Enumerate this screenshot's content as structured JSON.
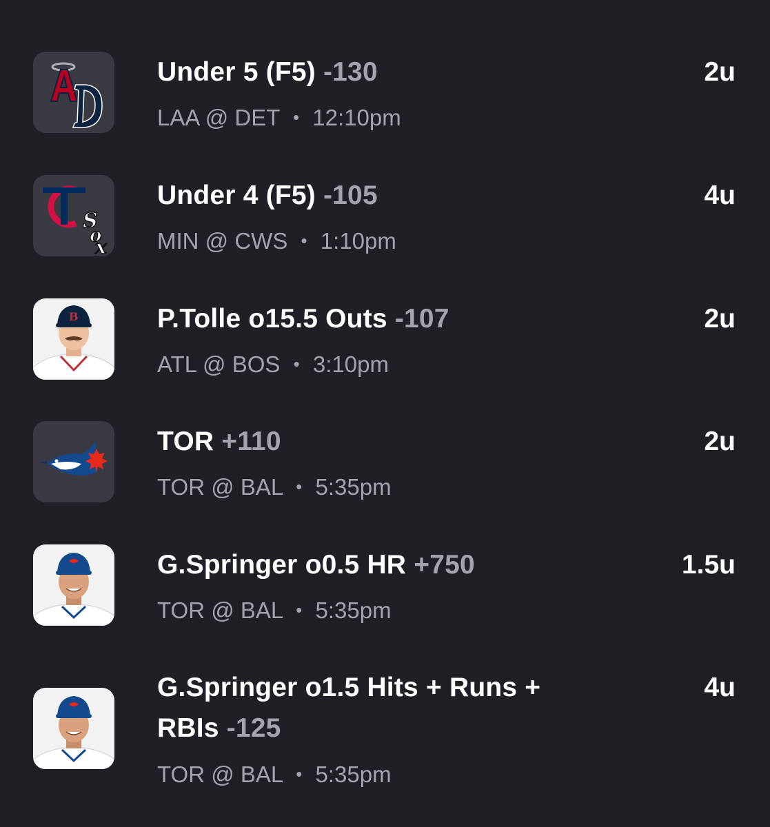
{
  "bets": [
    {
      "thumb": "angels-tigers-logos",
      "title": "Under 5 (F5)",
      "odds": "-130",
      "away": "LAA",
      "at": "@",
      "home": "DET",
      "sep": "•",
      "time": "12:10pm",
      "units": "2u"
    },
    {
      "thumb": "twins-whitesox-logos",
      "title": "Under 4 (F5)",
      "odds": "-105",
      "away": "MIN",
      "at": "@",
      "home": "CWS",
      "sep": "•",
      "time": "1:10pm",
      "units": "4u"
    },
    {
      "thumb": "player-headshot-tolle",
      "title": "P.Tolle o15.5 Outs",
      "odds": "-107",
      "away": "ATL",
      "at": "@",
      "home": "BOS",
      "sep": "•",
      "time": "3:10pm",
      "units": "2u"
    },
    {
      "thumb": "bluejays-logo",
      "title": "TOR",
      "odds": "+110",
      "away": "TOR",
      "at": "@",
      "home": "BAL",
      "sep": "•",
      "time": "5:35pm",
      "units": "2u"
    },
    {
      "thumb": "player-headshot-springer",
      "title": "G.Springer o0.5 HR",
      "odds": "+750",
      "away": "TOR",
      "at": "@",
      "home": "BAL",
      "sep": "•",
      "time": "5:35pm",
      "units": "1.5u"
    },
    {
      "thumb": "player-headshot-springer",
      "title": "G.Springer o1.5 Hits + Runs + RBIs",
      "odds": "-125",
      "away": "TOR",
      "at": "@",
      "home": "BAL",
      "sep": "•",
      "time": "5:35pm",
      "units": "4u"
    }
  ],
  "colors": {
    "background": "#1f1f25",
    "thumb_bg": "#3a3a42",
    "primary_text": "#ffffff",
    "secondary_text": "#a4a4ad"
  }
}
